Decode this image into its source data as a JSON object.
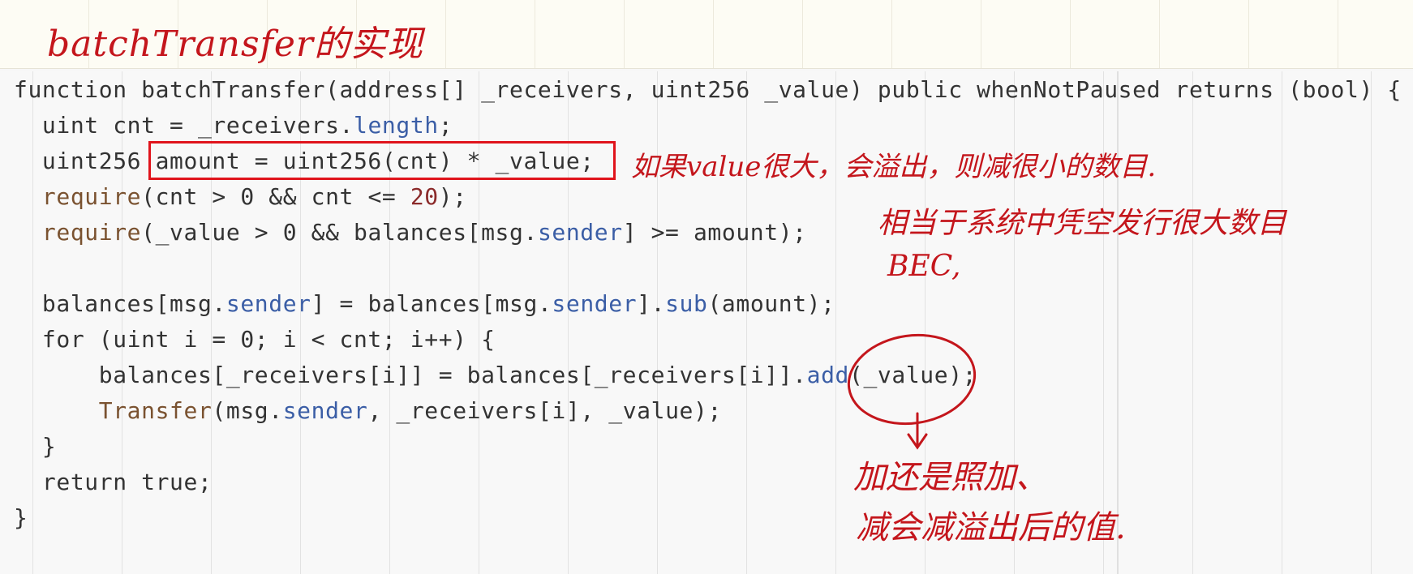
{
  "title": "batchTransfer的实现",
  "code_lines": [
    [
      [
        "function batchTransfer(address[] _receivers, uint256 _value) public whenNotPaused returns (bool) {",
        "plain"
      ]
    ],
    [
      [
        "  uint cnt = _receivers.",
        "plain"
      ],
      [
        "length",
        "member"
      ],
      [
        ";",
        "plain"
      ]
    ],
    [
      [
        "  uint256 amount = uint256(cnt) * _value;",
        "plain"
      ]
    ],
    [
      [
        "  ",
        "plain"
      ],
      [
        "require",
        "fn"
      ],
      [
        "(cnt > 0 && cnt <= ",
        "plain"
      ],
      [
        "20",
        "num"
      ],
      [
        ");",
        "plain"
      ]
    ],
    [
      [
        "  ",
        "plain"
      ],
      [
        "require",
        "fn"
      ],
      [
        "(_value > 0 && balances[msg.",
        "plain"
      ],
      [
        "sender",
        "member"
      ],
      [
        "] >= amount);",
        "plain"
      ]
    ],
    [
      [
        "",
        "plain"
      ]
    ],
    [
      [
        "  balances[msg.",
        "plain"
      ],
      [
        "sender",
        "member"
      ],
      [
        "] = balances[msg.",
        "plain"
      ],
      [
        "sender",
        "member"
      ],
      [
        "].",
        "plain"
      ],
      [
        "sub",
        "member"
      ],
      [
        "(amount);",
        "plain"
      ]
    ],
    [
      [
        "  for (uint i = 0; i < cnt; i++) {",
        "plain"
      ]
    ],
    [
      [
        "      balances[_receivers[i]] = balances[_receivers[i]].",
        "plain"
      ],
      [
        "add",
        "member"
      ],
      [
        "(_value);",
        "plain"
      ]
    ],
    [
      [
        "      ",
        "plain"
      ],
      [
        "Transfer",
        "fn"
      ],
      [
        "(msg.",
        "plain"
      ],
      [
        "sender",
        "member"
      ],
      [
        ", _receivers[i], _value);",
        "plain"
      ]
    ],
    [
      [
        "  }",
        "plain"
      ]
    ],
    [
      [
        "  return true;",
        "plain"
      ]
    ],
    [
      [
        "}",
        "plain"
      ]
    ]
  ],
  "annotations": {
    "overflow_note": "如果value很大，会溢出，则减很小的数目.",
    "issue_note": "相当于系统中凭空发行很大数目",
    "issue_note_2": "BEC,",
    "add_note": "加还是照加、",
    "sub_note": "减会减溢出后的值."
  },
  "colors": {
    "annotation": "#c4161c",
    "box": "#e0141c",
    "member": "#3b5ea6"
  }
}
